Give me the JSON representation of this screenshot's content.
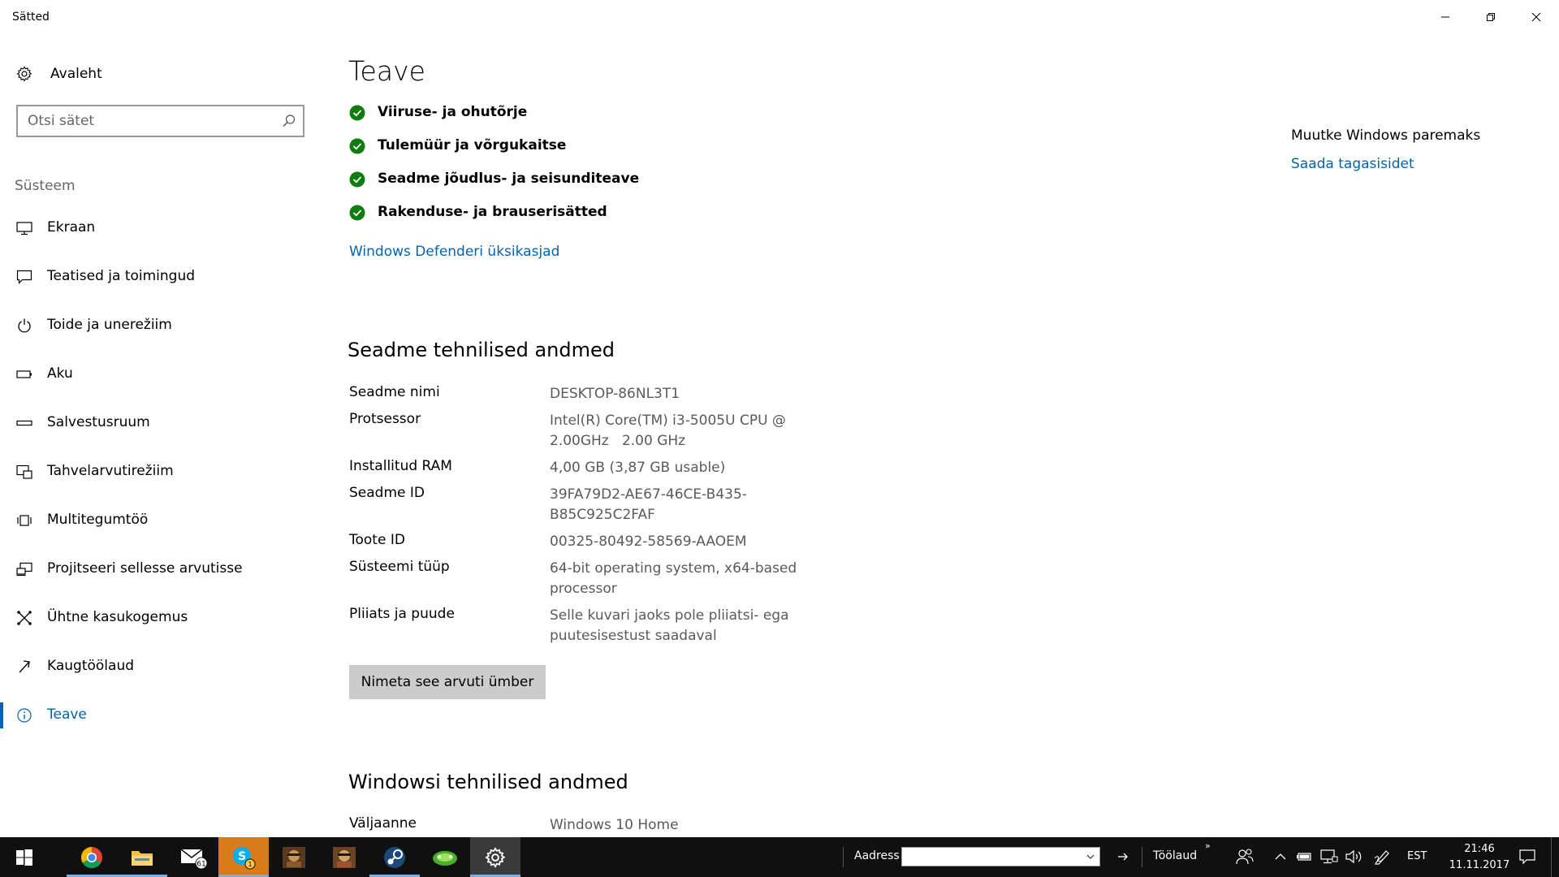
{
  "window": {
    "title": "Sätted"
  },
  "sidebar": {
    "home_label": "Avaleht",
    "search_placeholder": "Otsi sätet",
    "section_label": "Süsteem",
    "items": [
      {
        "label": "Ekraan",
        "icon": "monitor-icon"
      },
      {
        "label": "Teatised ja toimingud",
        "icon": "notification-icon"
      },
      {
        "label": "Toide ja unerežiim",
        "icon": "power-icon"
      },
      {
        "label": "Aku",
        "icon": "battery-icon"
      },
      {
        "label": "Salvestusruum",
        "icon": "storage-icon"
      },
      {
        "label": "Tahvelarvutirežiim",
        "icon": "tablet-mode-icon"
      },
      {
        "label": "Multitegumtöö",
        "icon": "multitasking-icon"
      },
      {
        "label": "Projitseeri sellesse arvutisse",
        "icon": "project-icon"
      },
      {
        "label": "Ühtne kasukogemus",
        "icon": "shared-experiences-icon"
      },
      {
        "label": "Kaugtöölaud",
        "icon": "remote-desktop-icon"
      },
      {
        "label": "Teave",
        "icon": "info-icon",
        "active": true
      }
    ]
  },
  "main": {
    "title": "Teave",
    "status_items": [
      "Viiruse- ja ohutõrje",
      "Tulemüür ja võrgukaitse",
      "Seadme jõudlus- ja seisunditeave",
      "Rakenduse- ja brauserisätted"
    ],
    "defender_link": "Windows Defenderi üksikasjad",
    "device_specs": {
      "heading": "Seadme tehnilised andmed",
      "rows": [
        {
          "label": "Seadme nimi",
          "value": "DESKTOP-86NL3T1"
        },
        {
          "label": "Protsessor",
          "value": "Intel(R) Core(TM) i3-5005U CPU @ 2.00GHz   2.00 GHz"
        },
        {
          "label": "Installitud RAM",
          "value": "4,00 GB (3,87 GB usable)"
        },
        {
          "label": "Seadme ID",
          "value": "39FA79D2-AE67-46CE-B435-B85C925C2FAF"
        },
        {
          "label": "Toote ID",
          "value": "00325-80492-58569-AAOEM"
        },
        {
          "label": "Süsteemi tüüp",
          "value": "64-bit operating system, x64-based processor"
        },
        {
          "label": "Pliiats ja puude",
          "value": "Selle kuvari jaoks pole pliiatsi- ega puutesisestust saadaval"
        }
      ],
      "rename_button": "Nimeta see arvuti ümber"
    },
    "windows_specs": {
      "heading": "Windowsi tehnilised andmed",
      "rows": [
        {
          "label": "Väljaanne",
          "value": "Windows 10 Home"
        }
      ]
    }
  },
  "right_panel": {
    "title": "Muutke Windows paremaks",
    "feedback_link": "Saada tagasisidet"
  },
  "taskbar": {
    "apps": [
      {
        "name": "chrome-icon"
      },
      {
        "name": "file-explorer-icon"
      },
      {
        "name": "mail-icon",
        "badge": "61"
      },
      {
        "name": "skype-icon",
        "badge": "1"
      },
      {
        "name": "game-icon-1"
      },
      {
        "name": "game-icon-2"
      },
      {
        "name": "steam-icon"
      },
      {
        "name": "game-icon-3"
      },
      {
        "name": "settings-icon"
      }
    ],
    "address_label": "Aadress",
    "desktop_label": "Töölaud",
    "language": "EST",
    "time": "21:46",
    "date": "11.11.2017"
  },
  "colors": {
    "accent": "#0063b1",
    "check_green": "#107c10",
    "taskbar": "#101010"
  }
}
